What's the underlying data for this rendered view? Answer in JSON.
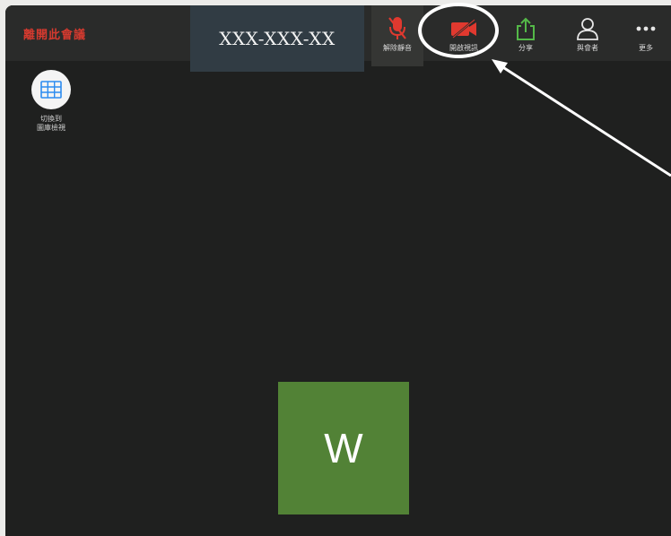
{
  "toolbar": {
    "leave_label": "離開此會議",
    "meeting_id": "XXX-XXX-XX",
    "items": [
      {
        "label": "解除靜音",
        "icon": "microphone-muted-icon",
        "color": "#e0392f"
      },
      {
        "label": "開啟視訊",
        "icon": "video-off-icon",
        "color": "#e0392f"
      },
      {
        "label": "分享",
        "icon": "share-upload-icon",
        "color": "#54b948"
      },
      {
        "label": "與會者",
        "icon": "participants-icon",
        "color": "#e6e6e6"
      },
      {
        "label": "更多",
        "icon": "more-dots-icon",
        "color": "#e6e6e6"
      }
    ]
  },
  "gallery_toggle": {
    "label": "切換到\n圖庫檢視",
    "icon": "grid-icon",
    "icon_color": "#2d8cf0"
  },
  "participant": {
    "initial": "W",
    "tile_color": "#528236"
  },
  "annotation": {
    "highlighted_item": "開啟視訊",
    "ring_color": "#ffffff"
  }
}
